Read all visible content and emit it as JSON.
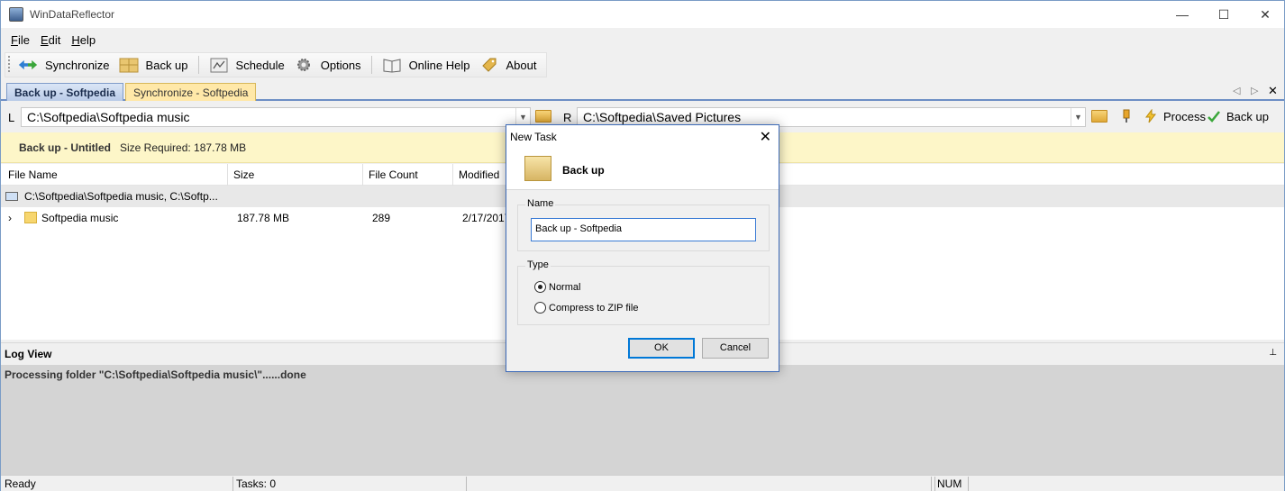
{
  "window": {
    "title": "WinDataReflector",
    "controls": [
      "—",
      "☐",
      "✕"
    ]
  },
  "menu": [
    {
      "key": "F",
      "rest": "ile"
    },
    {
      "key": "E",
      "rest": "dit"
    },
    {
      "key": "H",
      "rest": "elp"
    }
  ],
  "toolbar": {
    "synchronize": "Synchronize",
    "backup": "Back up",
    "schedule": "Schedule",
    "options": "Options",
    "online_help": "Online Help",
    "about": "About"
  },
  "tabs": [
    {
      "label": "Back up - Softpedia",
      "active": true
    },
    {
      "label": "Synchronize - Softpedia",
      "active": false
    }
  ],
  "tab_nav": {
    "prev": "◁",
    "next": "▷",
    "close": "✕"
  },
  "paths": {
    "left_label": "L",
    "left_path": "C:\\Softpedia\\Softpedia music",
    "right_label": "R",
    "right_path": "C:\\Softpedia\\Saved Pictures",
    "process": "Process",
    "backup": "Back up"
  },
  "info": {
    "title": "Back up - Untitled",
    "size_required": "Size Required: 187.78 MB"
  },
  "columns": [
    "File Name",
    "Size",
    "File Count",
    "Modified"
  ],
  "group_row": "C:\\Softpedia\\Softpedia music, C:\\Softp...",
  "rows": [
    {
      "name": "Softpedia music",
      "size": "187.78 MB",
      "count": "289",
      "modified": "2/17/2017"
    }
  ],
  "log": {
    "title": "Log View",
    "pin": "⊥",
    "message": "Processing folder \"C:\\Softpedia\\Softpedia music\\\"......done"
  },
  "status": {
    "ready": "Ready",
    "tasks": "Tasks: 0",
    "num": "NUM"
  },
  "dialog": {
    "title": "New Task",
    "close": "✕",
    "header": "Back up",
    "name_group": "Name",
    "name_value": "Back up - Softpedia",
    "type_group": "Type",
    "opt_normal": "Normal",
    "opt_zip": "Compress to ZIP file",
    "selected": "normal",
    "ok": "OK",
    "cancel": "Cancel"
  },
  "colors": {
    "accent": "#6d8ec5",
    "info_bg": "#fdf6c8",
    "tab_inactive": "#ffe8a8",
    "dialog_border": "#3c6ab8"
  }
}
